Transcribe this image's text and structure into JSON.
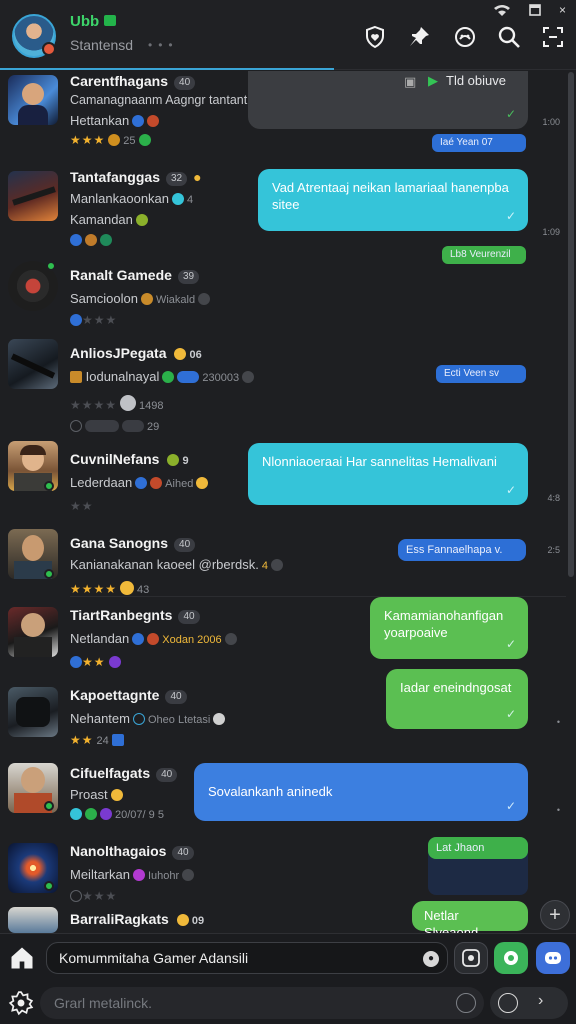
{
  "status_bar": {
    "wifi": "wifi-icon",
    "window": "window-icon",
    "close": "×"
  },
  "app": {
    "name": "Ubb",
    "status": "Stantensd",
    "status_extra": "•••"
  },
  "header_icons": [
    "heart-shield-icon",
    "pin-icon",
    "controller-icon",
    "search-icon",
    "scan-icon"
  ],
  "chats": [
    {
      "name": "Carentfhagans",
      "badge": "40",
      "preview": "Camanagnaanm Aagngr tantant. Indamaemcidg",
      "meta_label": "Hettankan",
      "stars": "★★★",
      "extra": "25",
      "bubble": {
        "text": "Tld obiuve",
        "style": "grey",
        "icon_label": "▶"
      },
      "pill": "Iaé Yean 07",
      "time": "1:00"
    },
    {
      "name": "Tantafanggas",
      "badge": "32",
      "preview": "Manlankaoonkan",
      "preview_extra": "4",
      "meta_label": "Kamandan",
      "bubble": {
        "text": "Vad Atrentaaj neikan lamariaal hanenpba sitee",
        "style": "cyan"
      },
      "pill": "Lb8 Veurenzil",
      "time": "1:09"
    },
    {
      "name": "Ranalt Gamede",
      "badge": "39",
      "preview": "Samcioolon",
      "preview_extra": "Wiakald",
      "meta_label": "",
      "stars": "★★★"
    },
    {
      "name": "AnliosJPegata",
      "badge": "",
      "name_extra": "06",
      "preview": "Iodunalnayal",
      "preview_extra": "230003",
      "stars_dim": "★★★★",
      "line3_extra": "1498",
      "line4": "29",
      "pill": "Ecti Veen sv"
    },
    {
      "name": "CuvnilNefans",
      "badge": "",
      "name_extra": "9",
      "preview": "Lederdaan",
      "preview_extra": "Aihed",
      "stars_dim": "★★",
      "bubble": {
        "text": "Nlonniaoeraai Har sannelitas Hemalivani",
        "style": "cyan"
      },
      "time": "4:8"
    },
    {
      "name": "Gana Sanogns",
      "badge": "40",
      "preview": "Kanianakanan kaoeel @rberdsk.",
      "preview_extra": "4",
      "stars": "★★★★",
      "line3_extra": "43",
      "pill": "Ess Fannaelhapa v.",
      "time": "2:5"
    },
    {
      "name": "TiartRanbegnts",
      "badge": "40",
      "preview": "Netlandan",
      "preview_extra": "Xodan 2006",
      "stars": "★★",
      "bubble": {
        "text": "Kamamianohanfigan yoarpoaive",
        "style": "green"
      }
    },
    {
      "name": "Kapoettagnte",
      "badge": "40",
      "preview": "Nehantem",
      "preview_extra": "Oheo Ltetasi",
      "stars": "★★",
      "line3_extra": "24",
      "bubble": {
        "text": "Iadar eneindngosat",
        "style": "green"
      },
      "time": "•"
    },
    {
      "name": "Cifuelfagats",
      "badge": "40",
      "preview": "Proast",
      "line3_extra": "20/07/ 9 5",
      "bubble": {
        "text": "Sovalankanh aninedk",
        "style": "blue"
      },
      "time": "•"
    },
    {
      "name": "Nanolthagaios",
      "badge": "40",
      "preview": "Meiltarkan",
      "preview_extra": "Iuhohr",
      "stars_dim": "★★★",
      "pill": "Lat Jhaon",
      "pill_style": "green"
    },
    {
      "name": "BarraliRagkats",
      "badge": "",
      "name_extra": "09",
      "bubble": {
        "text": "Netlar Slyeaond",
        "style": "green"
      }
    }
  ],
  "composer": {
    "input_value": "Komummitaha Gamer Adansili",
    "secondary_placeholder": "Grarl metalinck."
  }
}
